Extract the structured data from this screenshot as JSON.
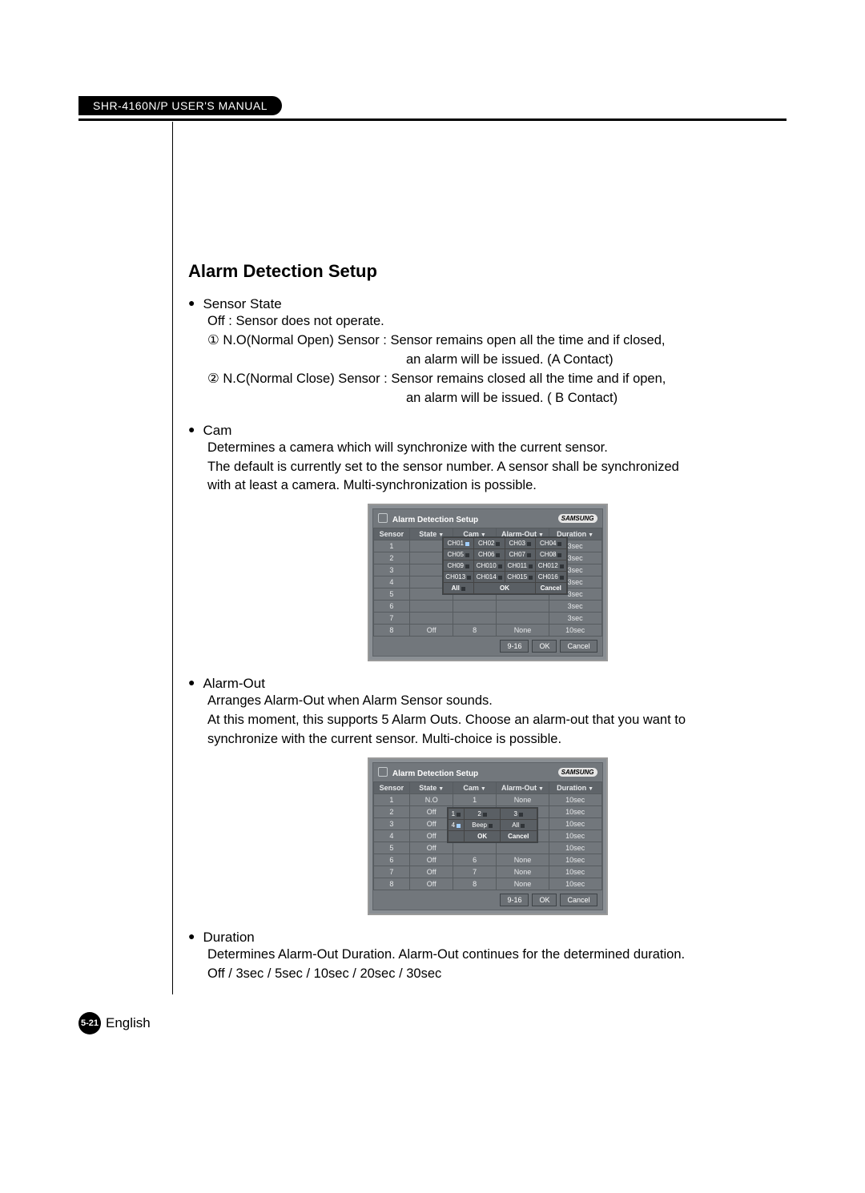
{
  "header": {
    "manual_title": "SHR-4160N/P USER'S MANUAL"
  },
  "section": {
    "title": "Alarm Detection Setup"
  },
  "sensor_state": {
    "heading": "Sensor State",
    "off_line": "Off : Sensor does not operate.",
    "no_line1": "① N.O(Normal Open) Sensor : Sensor remains open all the time and if closed,",
    "no_line2": "an alarm will be issued. (A Contact)",
    "nc_line1": "② N.C(Normal Close) Sensor : Sensor remains closed all the time and if open,",
    "nc_line2": "an alarm will be issued. ( B Contact)"
  },
  "cam": {
    "heading": "Cam",
    "line1": "Determines a camera which will synchronize with the current sensor.",
    "line2": "The default is currently set to the sensor number. A sensor shall be synchronized",
    "line3": "with at least a camera. Multi-synchronization is possible."
  },
  "alarm_out": {
    "heading": "Alarm-Out",
    "line1": "Arranges Alarm-Out when Alarm Sensor sounds.",
    "line2": "At this moment, this supports 5 Alarm Outs. Choose an alarm-out that you want to",
    "line3": "synchronize with the current sensor. Multi-choice is possible."
  },
  "duration": {
    "heading": "Duration",
    "line1": "Determines Alarm-Out Duration. Alarm-Out continues for the determined duration.",
    "line2": "Off / 3sec / 5sec / 10sec / 20sec / 30sec"
  },
  "dvr": {
    "title": "Alarm Detection Setup",
    "logo": "SAMSUNG",
    "cols": {
      "sensor": "Sensor",
      "state": "State",
      "cam": "Cam",
      "out": "Alarm-Out",
      "dur": "Duration"
    },
    "footer_buttons": {
      "page": "9-16",
      "ok": "OK",
      "cancel": "Cancel"
    }
  },
  "dvr1": {
    "rows": [
      {
        "sensor": "1",
        "state": "",
        "cam": "",
        "out": "",
        "dur": "3sec"
      },
      {
        "sensor": "2",
        "state": "",
        "cam": "",
        "out": "",
        "dur": "3sec"
      },
      {
        "sensor": "3",
        "state": "",
        "cam": "",
        "out": "",
        "dur": "3sec"
      },
      {
        "sensor": "4",
        "state": "",
        "cam": "",
        "out": "",
        "dur": "3sec"
      },
      {
        "sensor": "5",
        "state": "",
        "cam": "",
        "out": "",
        "dur": "3sec"
      },
      {
        "sensor": "6",
        "state": "",
        "cam": "",
        "out": "",
        "dur": "3sec"
      },
      {
        "sensor": "7",
        "state": "",
        "cam": "",
        "out": "",
        "dur": "3sec"
      },
      {
        "sensor": "8",
        "state": "Off",
        "cam": "8",
        "out": "None",
        "dur": "10sec"
      }
    ],
    "cam_popup": {
      "grid": [
        [
          "CH01",
          "CH02",
          "CH03",
          "CH04"
        ],
        [
          "CH05",
          "CH06",
          "CH07",
          "CH08"
        ],
        [
          "CH09",
          "CH010",
          "CH011",
          "CH012"
        ],
        [
          "CH013",
          "CH014",
          "CH015",
          "CH016"
        ]
      ],
      "all": "All",
      "ok": "OK",
      "cancel": "Cancel"
    }
  },
  "dvr2": {
    "rows": [
      {
        "sensor": "1",
        "state": "N.O",
        "cam": "1",
        "out": "None",
        "dur": "10sec"
      },
      {
        "sensor": "2",
        "state": "Off",
        "cam": "",
        "out": "",
        "dur": "10sec"
      },
      {
        "sensor": "3",
        "state": "Off",
        "cam": "",
        "out": "",
        "dur": "10sec"
      },
      {
        "sensor": "4",
        "state": "Off",
        "cam": "",
        "out": "",
        "dur": "10sec"
      },
      {
        "sensor": "5",
        "state": "Off",
        "cam": "",
        "out": "",
        "dur": "10sec"
      },
      {
        "sensor": "6",
        "state": "Off",
        "cam": "6",
        "out": "None",
        "dur": "10sec"
      },
      {
        "sensor": "7",
        "state": "Off",
        "cam": "7",
        "out": "None",
        "dur": "10sec"
      },
      {
        "sensor": "8",
        "state": "Off",
        "cam": "8",
        "out": "None",
        "dur": "10sec"
      }
    ],
    "alarm_popup": {
      "grid": [
        [
          "1",
          "2",
          "3"
        ],
        [
          "4",
          "Beep",
          "All"
        ]
      ],
      "ok": "OK",
      "cancel": "Cancel"
    }
  },
  "footer": {
    "page_num": "5-21",
    "lang": "English"
  }
}
